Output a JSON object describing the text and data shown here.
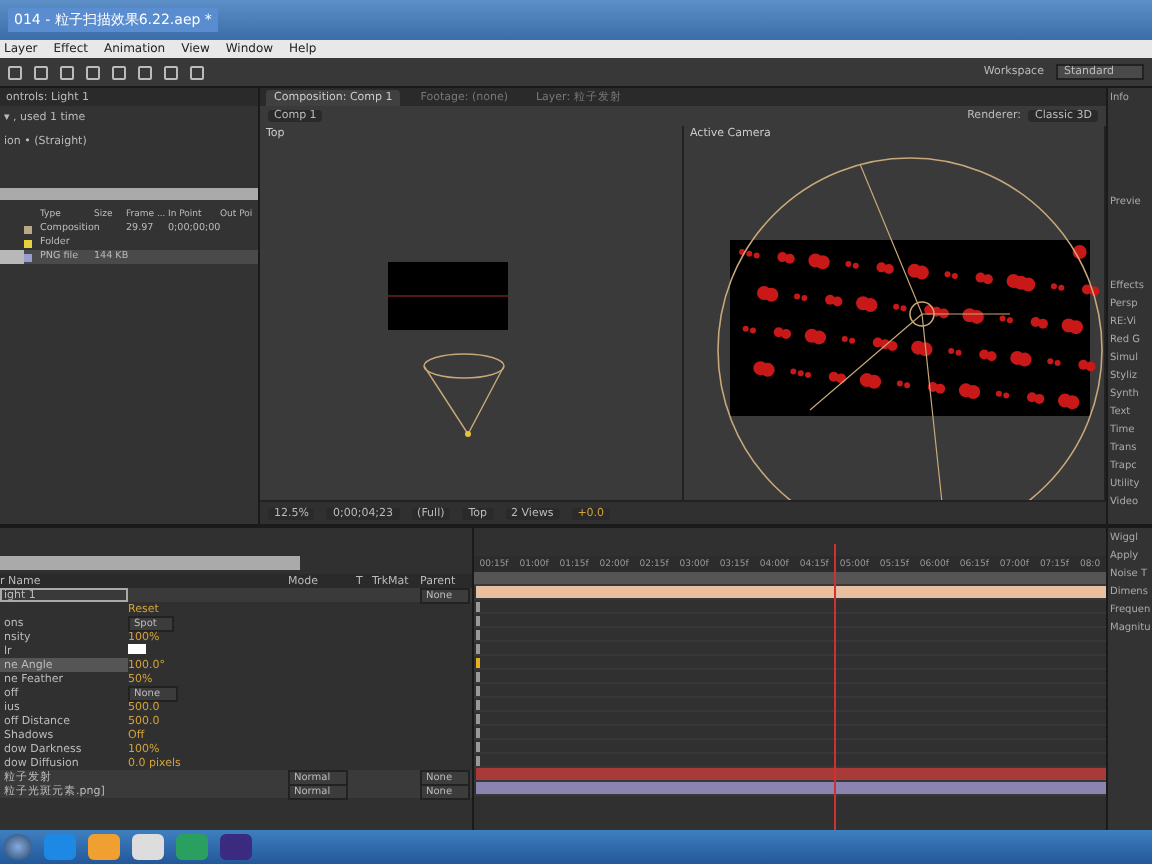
{
  "window": {
    "title": "014 - 粒子扫描效果6.22.aep *"
  },
  "menu": [
    "Layer",
    "Effect",
    "Animation",
    "View",
    "Window",
    "Help"
  ],
  "workspace": {
    "label": "Workspace",
    "value": "Standard"
  },
  "project": {
    "header": "ontrols: Light 1",
    "info": [
      "▾ , used 1 time",
      "ion • (Straight)"
    ],
    "columns": [
      "Type",
      "Size",
      "Frame ...",
      "In Point",
      "Out Poi"
    ],
    "items": [
      {
        "type": "Composition",
        "frame": "29.97",
        "in": "0;00;00;00",
        "color": "#b8a98a",
        "selected": false
      },
      {
        "type": "Folder",
        "color": "#e6d23c",
        "selected": false
      },
      {
        "type": "PNG file",
        "size": "144 KB",
        "color": "#9c9cd0",
        "selected": true
      }
    ]
  },
  "viewer": {
    "tabs": [
      {
        "label": "Composition: Comp 1",
        "selected": true
      },
      {
        "label": "Footage: (none)",
        "selected": false
      },
      {
        "label": "Layer: 粒子发射",
        "selected": false
      }
    ],
    "chip": "Comp 1",
    "renderer": {
      "label": "Renderer:",
      "value": "Classic 3D"
    },
    "views": [
      {
        "kind": "top",
        "label": "Top"
      },
      {
        "kind": "camera",
        "label": "Active Camera"
      }
    ],
    "bar": {
      "zoom": "12.5%",
      "time": "0;00;04;23",
      "resolution": "(Full)",
      "view": "Top",
      "layout": "2 Views",
      "exposure": "+0.0"
    }
  },
  "right": {
    "info": "Info",
    "preview": "Previe",
    "effects": "Effects",
    "effect_items": [
      "Persp",
      "RE:Vi",
      "Red G",
      "Simul",
      "Styliz",
      "Synth",
      "Text",
      "Time",
      "Trans",
      "Trapc",
      "Utility",
      "Video"
    ]
  },
  "timeline": {
    "columns": [
      "r Name",
      "Mode",
      "T",
      "TrkMat",
      "Parent"
    ],
    "ruler": [
      "00:15f",
      "01:00f",
      "01:15f",
      "02:00f",
      "02:15f",
      "03:00f",
      "03:15f",
      "04:00f",
      "04:15f",
      "05:00f",
      "05:15f",
      "06:00f",
      "06:15f",
      "07:00f",
      "07:15f",
      "08:0"
    ],
    "rows": [
      {
        "kind": "layer",
        "name": "ight 1",
        "parent": "None",
        "color": "#e8c0a0",
        "selected": true
      },
      {
        "kind": "prop",
        "value": "Reset",
        "selected": false
      },
      {
        "kind": "dropdown",
        "name": "ons",
        "value": "Spot",
        "selected": false
      },
      {
        "kind": "prop",
        "name": "nsity",
        "value": "100%",
        "selected": false
      },
      {
        "kind": "swatch",
        "name": "lr",
        "selected": false
      },
      {
        "kind": "prop",
        "name": "ne Angle",
        "value": "100.0°",
        "selected": true
      },
      {
        "kind": "prop",
        "name": "ne Feather",
        "value": "50%",
        "selected": false
      },
      {
        "kind": "dropdown",
        "name": "off",
        "value": "None",
        "selected": false
      },
      {
        "kind": "prop",
        "name": "ius",
        "value": "500.0",
        "selected": false
      },
      {
        "kind": "prop",
        "name": "off Distance",
        "value": "500.0",
        "selected": false
      },
      {
        "kind": "prop",
        "name": "Shadows",
        "value": "Off",
        "selected": false
      },
      {
        "kind": "prop",
        "name": "dow Darkness",
        "value": "100%",
        "selected": false
      },
      {
        "kind": "prop",
        "name": "dow Diffusion",
        "value": "0.0 pixels",
        "selected": false
      },
      {
        "kind": "layer",
        "name": "粒子发射",
        "mode": "Normal",
        "parent": "None",
        "color": "#a83a3a",
        "selected": false
      },
      {
        "kind": "layer",
        "name": "粒子光斑元素.png]",
        "mode": "Normal",
        "parent": "None",
        "color": "#8c84b0",
        "selected": false
      }
    ]
  },
  "wiggler": {
    "header": "Wiggl",
    "labels": [
      "Apply",
      "Noise T",
      "Dimens",
      "Frequen",
      "Magnitu"
    ]
  }
}
